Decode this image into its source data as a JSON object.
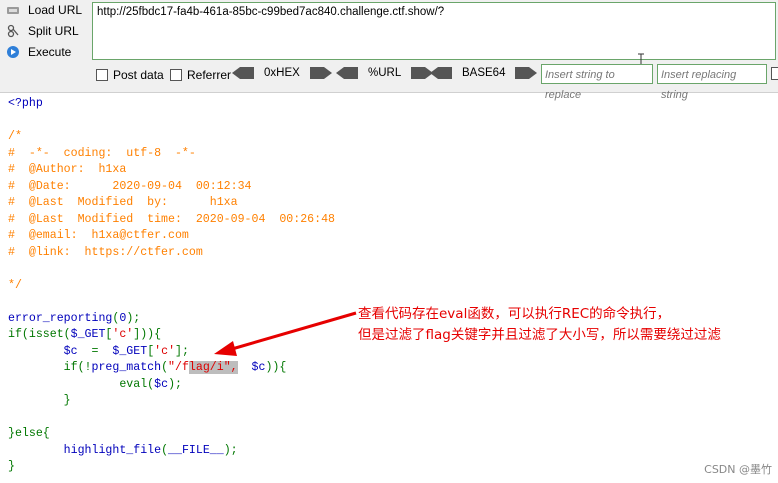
{
  "side_menu": {
    "load_url": "Load URL",
    "split_url": "Split URL",
    "execute": "Execute"
  },
  "url_bar": {
    "value": "http://25fbdc17-fa4b-461a-85bc-c99bed7ac840.challenge.ctf.show/?"
  },
  "options": {
    "post_data": "Post data",
    "referrer": "Referrer",
    "hex": "0xHEX",
    "url": "%URL",
    "base64": "BASE64",
    "insert_placeholder": "Insert string to replace",
    "replacing_placeholder": "Insert replacing string"
  },
  "code": {
    "l1": "<?php",
    "l3": "/*",
    "l4": "#  -*-  coding:  utf-8  -*-",
    "l5": "#  @Author:  h1xa",
    "l6": "#  @Date:      2020-09-04  00:12:34",
    "l7": "#  @Last  Modified  by:      h1xa",
    "l8": "#  @Last  Modified  time:  2020-09-04  00:26:48",
    "l9": "#  @email:  h1xa@ctfer.com",
    "l10": "#  @link:  https://ctfer.com",
    "l12": "*/",
    "l14a": "error_reporting",
    "l14b": "(",
    "l14c": "0",
    "l14d": ");",
    "l15a": "if(isset(",
    "l15b": "$_GET",
    "l15c": "[",
    "l15d": "'c'",
    "l15e": "])){",
    "l16a": "        ",
    "l16b": "$c ",
    "l16c": " =  ",
    "l16d": "$_GET",
    "l16e": "[",
    "l16f": "'c'",
    "l16g": "];",
    "l17a": "        if(!",
    "l17b": "preg_match",
    "l17c": "(",
    "l17d": "\"/f",
    "l17e": "lag/i\",",
    "l17f": "  ",
    "l17g": "$c",
    "l17h": ")){",
    "l18a": "                ",
    "l18b": "eval",
    "l18c": "(",
    "l18d": "$c",
    "l18e": ");",
    "l19": "        }",
    "l21": "}else{",
    "l22a": "        ",
    "l22b": "highlight_file",
    "l22c": "(",
    "l22d": "__FILE__",
    "l22e": ");",
    "l23": "}"
  },
  "annotation": {
    "line1": "查看代码存在eval函数，可以执行REC的命令执行，",
    "line2": "但是过滤了flag关键字并且过滤了大小写，所以需要绕过过滤"
  },
  "watermark": "CSDN @墨竹",
  "colors": {
    "comment": "#ff8000",
    "keyword": "#007700",
    "default": "#0000bb",
    "string": "#dd0000",
    "annotation": "#e60000"
  }
}
